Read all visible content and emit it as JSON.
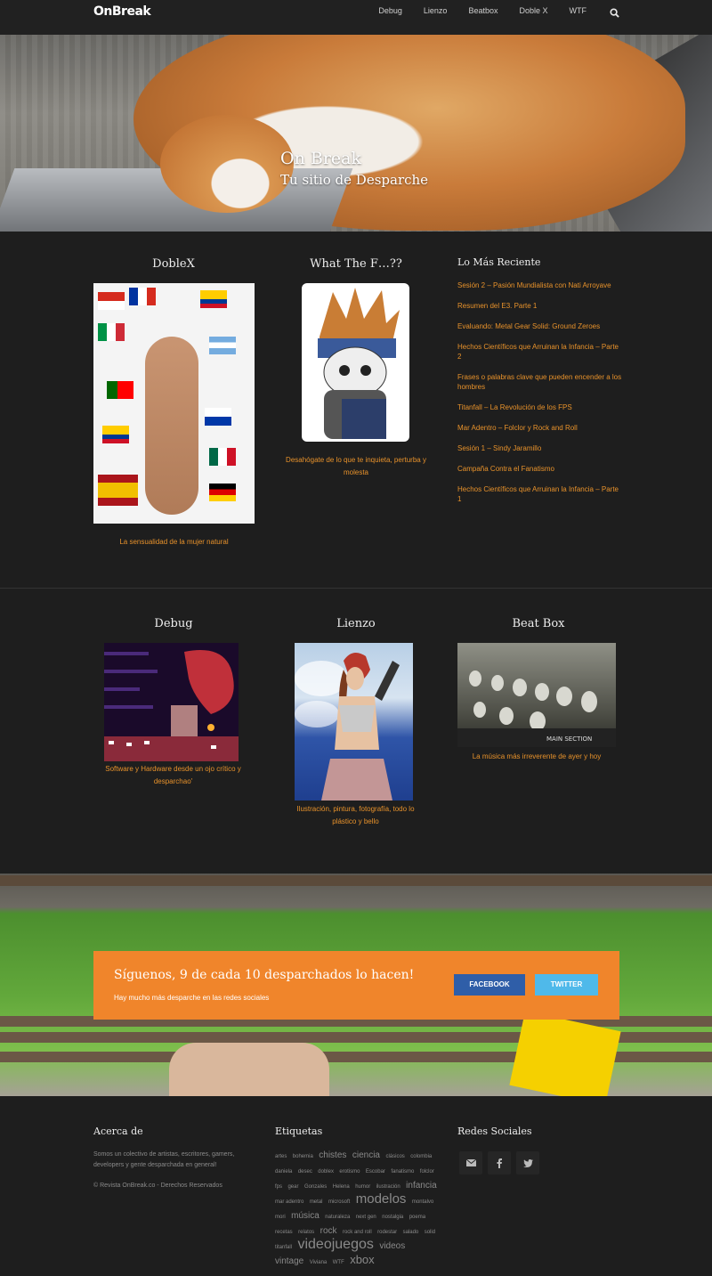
{
  "nav": {
    "logo": "OnBreak",
    "links": [
      "Debug",
      "Lienzo",
      "Beatbox",
      "Doble X",
      "WTF"
    ]
  },
  "hero": {
    "title": "On Break",
    "subtitle": "Tu sitio de Desparche"
  },
  "featured": [
    {
      "title": "DobleX",
      "caption": "La sensualidad de la mujer natural"
    },
    {
      "title": "What The F…??",
      "caption": "Desahógate de lo que te inquieta, perturba y molesta"
    }
  ],
  "recent": {
    "title": "Lo Más Reciente",
    "items": [
      "Sesión 2 – Pasión Mundialista con Nati Arroyave",
      "Resumen del E3. Parte 1",
      "Evaluando: Metal Gear Solid: Ground Zeroes",
      "Hechos Científicos que Arruinan la Infancia – Parte 2",
      "Frases o palabras clave que pueden encender a los hombres",
      "Titanfall – La Revolución de los FPS",
      "Mar Adentro – Folclor y Rock and Roll",
      "Sesión 1 – Sindy Jaramillo",
      "Campaña Contra el Fanatismo",
      "Hechos Científicos que Arruinan la Infancia – Parte 1"
    ]
  },
  "categories": [
    {
      "title": "Debug",
      "caption": "Software y Hardware desde un ojo crítico y desparchao'"
    },
    {
      "title": "Lienzo",
      "caption": "Ilustración, pintura, fotografía, todo lo plástico y bello"
    },
    {
      "title": "Beat Box",
      "caption": "La música más irreverente de ayer y hoy"
    }
  ],
  "follow": {
    "title": "Síguenos, 9 de cada 10 desparchados lo hacen!",
    "subtitle": "Hay mucho más desparche en las redes sociales",
    "facebook": "FACEBOOK",
    "twitter": "TWITTER"
  },
  "footer": {
    "about_title": "Acerca de",
    "about_text": "Somos un colectivo de artistas, escritores, gamers, developers y gente desparchada en general!",
    "copyright": "© Revista OnBreak.co - Derechos Reservados",
    "tags_title": "Etiquetas",
    "tags": [
      {
        "t": "artes",
        "s": 1
      },
      {
        "t": "bohemia",
        "s": 1
      },
      {
        "t": "chistes",
        "s": 3
      },
      {
        "t": "ciencia",
        "s": 3
      },
      {
        "t": "clásicos",
        "s": 1
      },
      {
        "t": "colombia",
        "s": 1
      },
      {
        "t": "daniela",
        "s": 1
      },
      {
        "t": "desec",
        "s": 1
      },
      {
        "t": "doblex",
        "s": 1
      },
      {
        "t": "erotismo",
        "s": 1
      },
      {
        "t": "Escobar",
        "s": 1
      },
      {
        "t": "fanatismo",
        "s": 1
      },
      {
        "t": "folclor",
        "s": 1
      },
      {
        "t": "fps",
        "s": 1
      },
      {
        "t": "gear",
        "s": 1
      },
      {
        "t": "Gonzales",
        "s": 1
      },
      {
        "t": "Helena",
        "s": 1
      },
      {
        "t": "humor",
        "s": 1
      },
      {
        "t": "ilustración",
        "s": 1
      },
      {
        "t": "infancia",
        "s": 3
      },
      {
        "t": "mar adentro",
        "s": 1
      },
      {
        "t": "metal",
        "s": 1
      },
      {
        "t": "microsoft",
        "s": 1
      },
      {
        "t": "modelos",
        "s": 5
      },
      {
        "t": "montalvo",
        "s": 1
      },
      {
        "t": "mori",
        "s": 1
      },
      {
        "t": "música",
        "s": 3
      },
      {
        "t": "naturaleza",
        "s": 1
      },
      {
        "t": "next gen",
        "s": 1
      },
      {
        "t": "nostalgia",
        "s": 1
      },
      {
        "t": "poema",
        "s": 1
      },
      {
        "t": "recetas",
        "s": 1
      },
      {
        "t": "relatos",
        "s": 1
      },
      {
        "t": "rock",
        "s": 3
      },
      {
        "t": "rock and roll",
        "s": 1
      },
      {
        "t": "rodestar",
        "s": 1
      },
      {
        "t": "salado",
        "s": 1
      },
      {
        "t": "solid",
        "s": 1
      },
      {
        "t": "titanfall",
        "s": 1
      },
      {
        "t": "videojuegos",
        "s": 6
      },
      {
        "t": "videos",
        "s": 3
      },
      {
        "t": "vintage",
        "s": 3
      },
      {
        "t": "Viviana",
        "s": 1
      },
      {
        "t": "WTF",
        "s": 1
      },
      {
        "t": "xbox",
        "s": 4
      }
    ],
    "social_title": "Redes Sociales",
    "social_icons": [
      "envelope-icon",
      "facebook-icon",
      "twitter-icon"
    ]
  },
  "colors": {
    "accent": "#f0852b",
    "link": "#e8922b",
    "facebook": "#2f5ea8",
    "twitter": "#4fb9ea"
  }
}
